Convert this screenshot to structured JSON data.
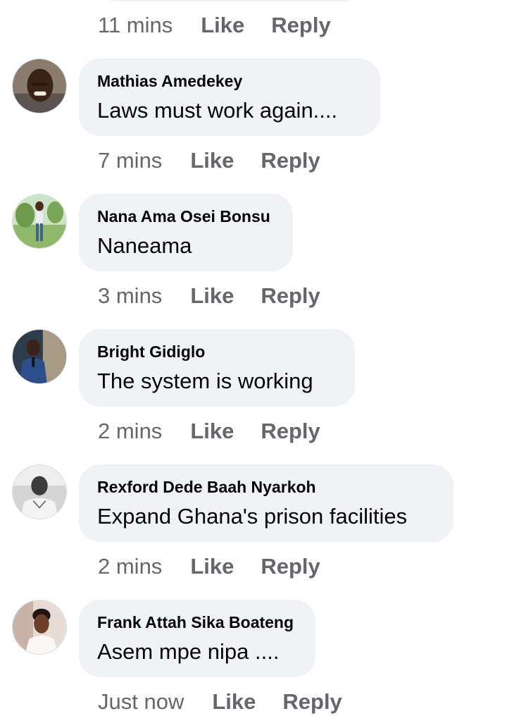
{
  "previous": {
    "time": "11 mins",
    "like_label": "Like",
    "reply_label": "Reply"
  },
  "comments": [
    {
      "author": "Mathias Amedekey",
      "text": "Laws must work again....",
      "time": "7 mins",
      "like_label": "Like",
      "reply_label": "Reply"
    },
    {
      "author": "Nana Ama Osei Bonsu",
      "text": "Naneama",
      "time": "3 mins",
      "like_label": "Like",
      "reply_label": "Reply"
    },
    {
      "author": "Bright Gidiglo",
      "text": "The system is working",
      "time": "2 mins",
      "like_label": "Like",
      "reply_label": "Reply"
    },
    {
      "author": "Rexford Dede Baah Nyarkoh",
      "text": "Expand Ghana's prison facilities",
      "time": "2 mins",
      "like_label": "Like",
      "reply_label": "Reply"
    },
    {
      "author": "Frank Attah Sika Boateng",
      "text": "Asem mpe nipa ....",
      "time": "Just now",
      "like_label": "Like",
      "reply_label": "Reply"
    }
  ],
  "colors": {
    "bubble_background": "#f0f2f5",
    "meta_text": "#65676b",
    "primary_text": "#050505"
  }
}
